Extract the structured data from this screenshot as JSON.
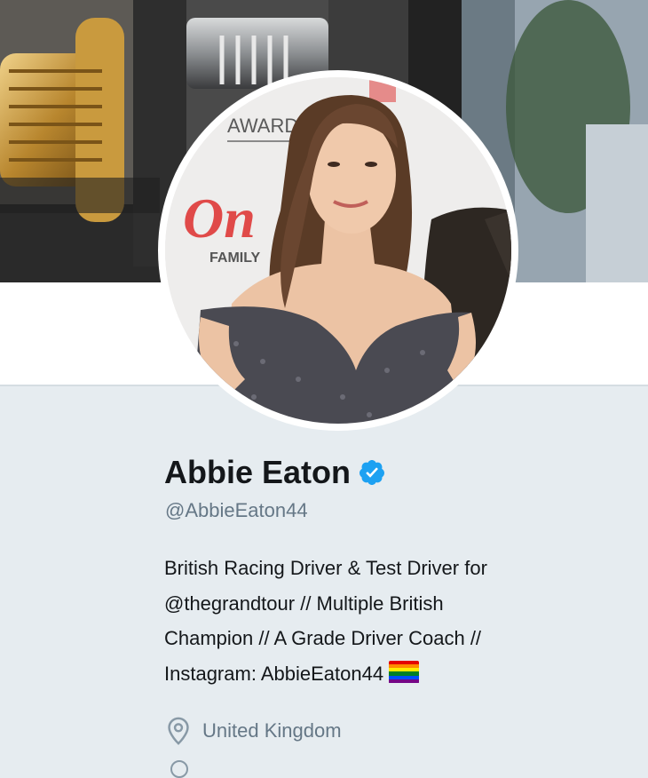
{
  "profile": {
    "name": "Abbie Eaton",
    "handle": "@AbbieEaton44",
    "verified": true,
    "bio_lines": [
      "British Racing Driver & Test Driver for",
      "@thegrandtour // Multiple British",
      "Champion // A Grade Driver Coach //",
      "Instagram: AbbieEaton44"
    ],
    "bio_emoji": "rainbow-flag",
    "location": "United Kingdom"
  },
  "avatar_backdrop": {
    "line1": "AWARDS",
    "line2": "On",
    "line3": "FAMILY"
  },
  "icons": {
    "verified": "verified-badge-icon",
    "location": "map-pin-icon",
    "flag": "rainbow-flag-icon"
  },
  "colors": {
    "background": "#e6ecf0",
    "verified_blue": "#1da1f2",
    "secondary_text": "#657786",
    "primary_text": "#14171a"
  }
}
